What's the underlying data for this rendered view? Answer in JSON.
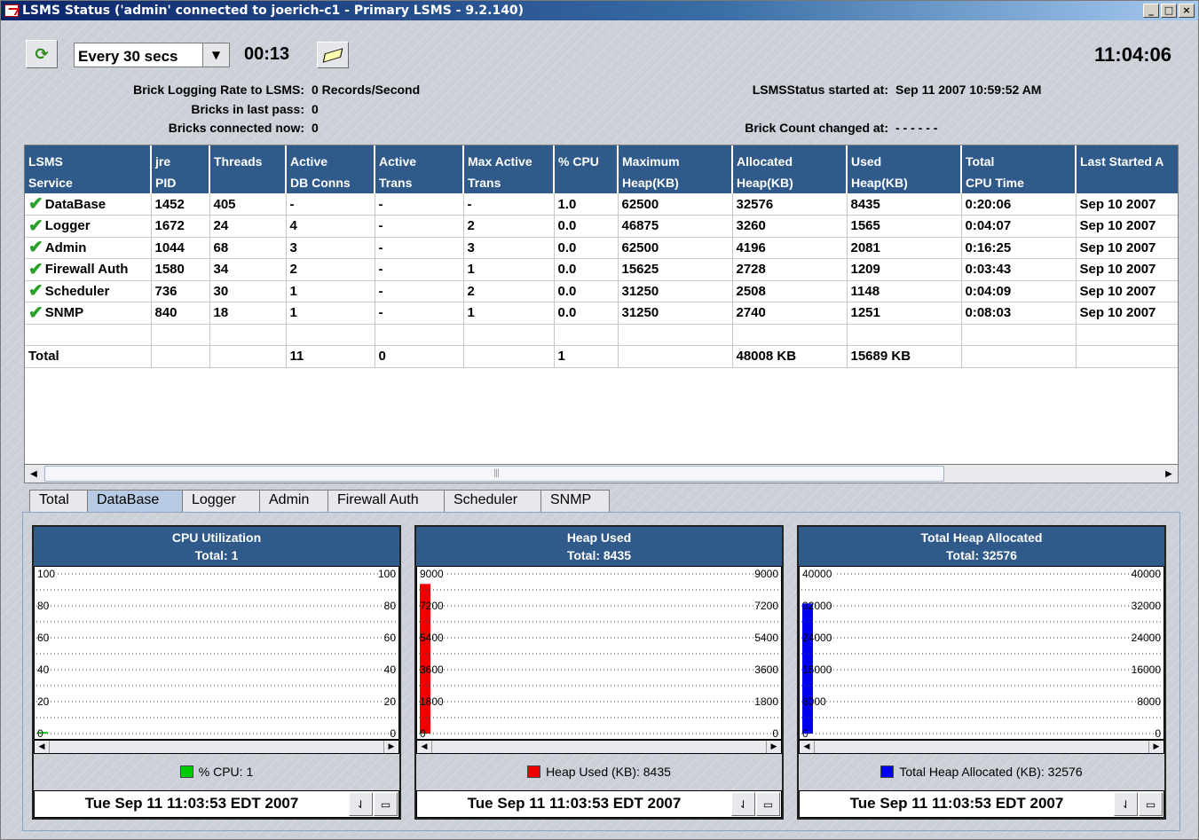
{
  "window": {
    "title": "LSMS Status ('admin' connected to joerich-c1 - Primary LSMS - 9.2.140)",
    "controls": [
      "_",
      "□",
      "×"
    ]
  },
  "toolbar": {
    "refresh_icon": "refresh-arrows-icon",
    "interval": "Every 30 secs",
    "countdown": "00:13",
    "clear_icon": "eraser-icon",
    "clock": "11:04:06"
  },
  "info": {
    "rate_label": "Brick Logging Rate to LSMS:",
    "rate_value": "0 Records/Second",
    "last_pass_label": "Bricks in last pass:",
    "last_pass_value": "0",
    "connected_label": "Bricks connected now:",
    "connected_value": "0",
    "started_label": "LSMSStatus started at:",
    "started_value": "Sep 11  2007 10:59:52 AM",
    "count_changed_label": "Brick Count changed at:",
    "count_changed_value": "- - - - - -"
  },
  "table": {
    "headers": [
      [
        "LSMS",
        "Service"
      ],
      [
        "jre",
        "PID"
      ],
      [
        "Threads",
        ""
      ],
      [
        "Active",
        "DB Conns"
      ],
      [
        "Active",
        "Trans"
      ],
      [
        "Max Active",
        "Trans"
      ],
      [
        "% CPU",
        ""
      ],
      [
        "Maximum",
        "Heap(KB)"
      ],
      [
        "Allocated",
        "Heap(KB)"
      ],
      [
        "Used",
        "Heap(KB)"
      ],
      [
        "Total",
        "CPU Time"
      ],
      [
        "Last Started A",
        ""
      ]
    ],
    "rows": [
      [
        "DataBase",
        "1452",
        "405",
        "-",
        "-",
        "-",
        "1.0",
        "62500",
        "32576",
        "8435",
        "0:20:06",
        "Sep 10  2007"
      ],
      [
        "Logger",
        "1672",
        "24",
        "4",
        "-",
        "2",
        "0.0",
        "46875",
        "3260",
        "1565",
        "0:04:07",
        "Sep 10  2007"
      ],
      [
        "Admin",
        "1044",
        "68",
        "3",
        "-",
        "3",
        "0.0",
        "62500",
        "4196",
        "2081",
        "0:16:25",
        "Sep 10  2007"
      ],
      [
        "Firewall Auth",
        "1580",
        "34",
        "2",
        "-",
        "1",
        "0.0",
        "15625",
        "2728",
        "1209",
        "0:03:43",
        "Sep 10  2007"
      ],
      [
        "Scheduler",
        "736",
        "30",
        "1",
        "-",
        "2",
        "0.0",
        "31250",
        "2508",
        "1148",
        "0:04:09",
        "Sep 10  2007"
      ],
      [
        "SNMP",
        "840",
        "18",
        "1",
        "-",
        "1",
        "0.0",
        "31250",
        "2740",
        "1251",
        "0:08:03",
        "Sep 10  2007"
      ]
    ],
    "total": [
      "Total",
      "",
      "",
      "11",
      "0",
      "",
      "1",
      "",
      "48008 KB",
      "15689 KB",
      "",
      ""
    ],
    "status_icon": "green-check-icon"
  },
  "tabs": [
    "Total",
    "DataBase",
    "Logger",
    "Admin",
    "Firewall Auth",
    "Scheduler",
    "SNMP"
  ],
  "active_tab": "DataBase",
  "colors": {
    "header_blue": "#2f5a8a",
    "cpu": "#00cc00",
    "heap_used": "#ee0000",
    "heap_alloc": "#0000ee"
  },
  "charts": [
    {
      "title": "CPU Utilization",
      "total": "Total: 1",
      "legend": "% CPU: 1",
      "timestamp": "Tue Sep 11 11:03:53 EDT 2007"
    },
    {
      "title": "Heap Used",
      "total": "Total: 8435",
      "legend": "Heap Used (KB): 8435",
      "timestamp": "Tue Sep 11 11:03:53 EDT 2007"
    },
    {
      "title": "Total Heap Allocated",
      "total": "Total: 32576",
      "legend": "Total Heap Allocated (KB): 32576",
      "timestamp": "Tue Sep 11 11:03:53 EDT 2007"
    }
  ],
  "chart_data": [
    {
      "type": "bar",
      "title": "CPU Utilization",
      "series": [
        {
          "name": "% CPU",
          "values": [
            1
          ]
        }
      ],
      "ylim": [
        0,
        100
      ],
      "yticks": [
        0,
        20,
        40,
        60,
        80,
        100
      ],
      "color": "#00cc00"
    },
    {
      "type": "bar",
      "title": "Heap Used",
      "series": [
        {
          "name": "Heap Used (KB)",
          "values": [
            8435
          ]
        }
      ],
      "ylim": [
        0,
        9000
      ],
      "yticks": [
        0,
        1800,
        3600,
        5400,
        7200,
        9000
      ],
      "color": "#ee0000"
    },
    {
      "type": "bar",
      "title": "Total Heap Allocated",
      "series": [
        {
          "name": "Total Heap Allocated (KB)",
          "values": [
            32576
          ]
        }
      ],
      "ylim": [
        0,
        40000
      ],
      "yticks": [
        0,
        8000,
        16000,
        24000,
        32000,
        40000
      ],
      "color": "#0000ee"
    }
  ]
}
